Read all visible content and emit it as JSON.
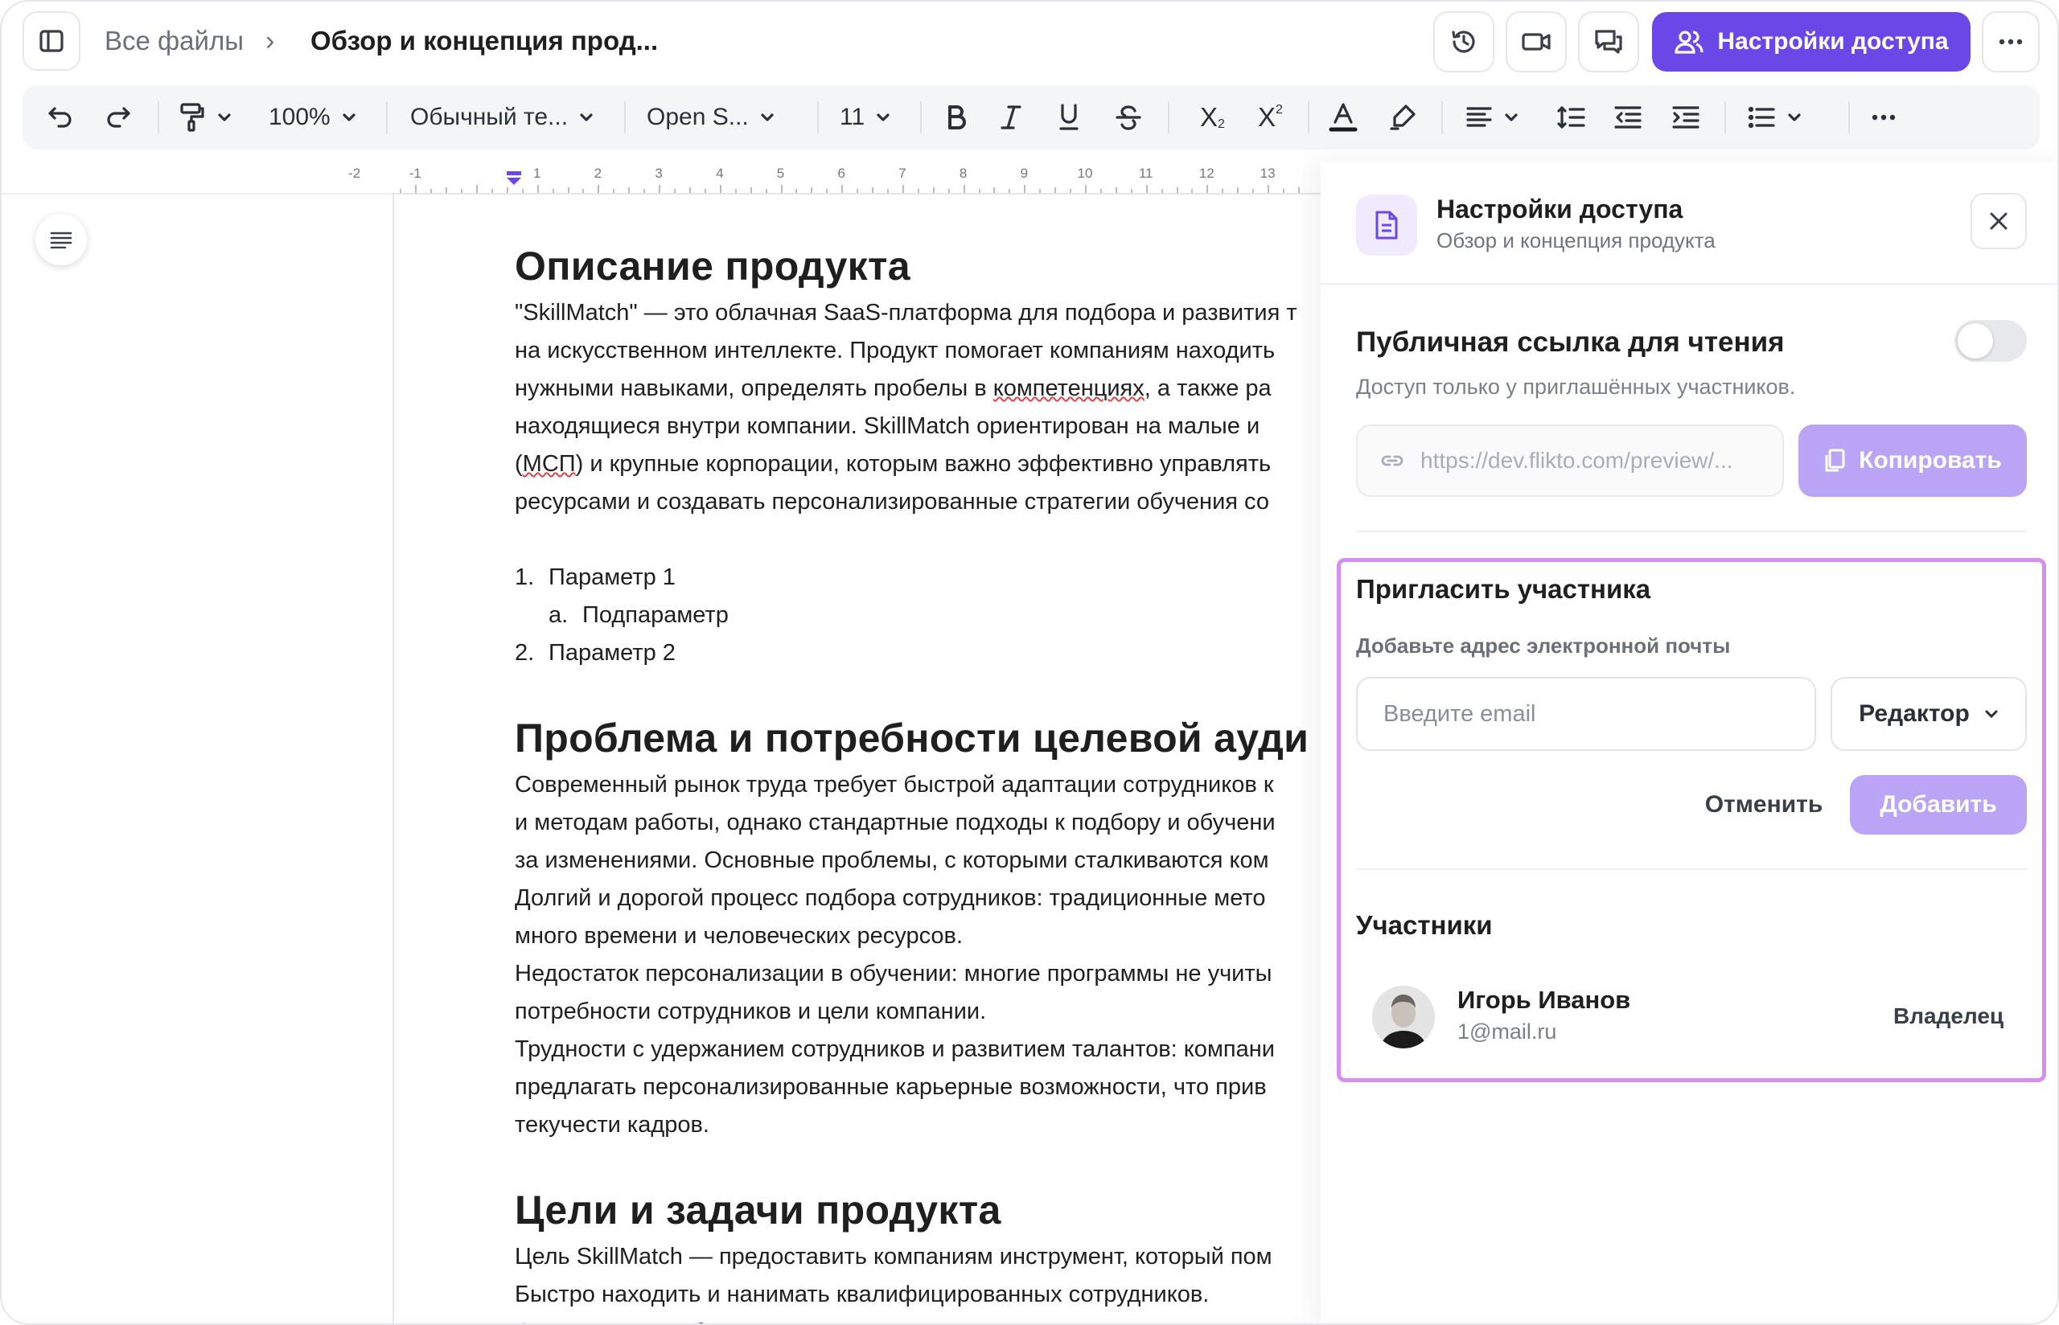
{
  "topbar": {
    "breadcrumb_root": "Все файлы",
    "breadcrumb_sep": "›",
    "document_title": "Обзор и концепция прод...",
    "access_button": "Настройки доступа"
  },
  "toolbar": {
    "zoom": "100%",
    "style": "Обычный те...",
    "font": "Open S...",
    "size": "11",
    "subscript_label": "X",
    "superscript_label": "X"
  },
  "ruler": {
    "numbers": [
      "-2",
      "-1",
      "1",
      "2",
      "3",
      "4",
      "5",
      "6",
      "7",
      "8",
      "9",
      "10",
      "11",
      "12",
      "13"
    ]
  },
  "document": {
    "h1": "Описание продукта",
    "p1": [
      "\"SkillMatch\" — это облачная SaaS-платформа для подбора и развития т",
      "на искусственном интеллекте. Продукт помогает компаниям находить",
      "нужными навыками, определять пробелы в компетенциях, а также ра",
      "находящиеся внутри компании. SkillMatch ориентирован на малые и",
      "(МСП) и крупные корпорации, которым важно эффективно управлять",
      "ресурсами и создавать персонализированные стратегии обучения со"
    ],
    "list": [
      {
        "marker": "1.",
        "text": "Параметр 1"
      },
      {
        "marker": "a.",
        "text": "Подпараметр"
      },
      {
        "marker": "2.",
        "text": "Параметр 2"
      }
    ],
    "h2": "Проблема и потребности целевой ауди",
    "p2": [
      "Современный рынок труда требует быстрой адаптации сотрудников к",
      "и методам работы, однако стандартные подходы к подбору и обучени",
      "за изменениями. Основные проблемы, с которыми сталкиваются ком",
      "Долгий и дорогой процесс подбора сотрудников: традиционные мето",
      "много времени и человеческих ресурсов.",
      "Недостаток персонализации в обучении: многие программы не учиты",
      "потребности сотрудников и цели компании.",
      "Трудности с удержанием сотрудников и развитием талантов: компани",
      "предлагать персонализированные карьерные возможности, что прив",
      "текучести кадров."
    ],
    "h3": "Цели и задачи продукта",
    "p3": [
      "Цель SkillMatch — предоставить компаниям инструмент, который пом",
      "Быстро находить и нанимать квалифицированных сотрудников.",
      "Определять пробелы в навыках и строить персонализированные пла"
    ]
  },
  "panel": {
    "title": "Настройки доступа",
    "subtitle": "Обзор и концепция продукта",
    "public_link_title": "Публичная ссылка для чтения",
    "public_link_desc": "Доступ только у приглашённых участников.",
    "public_link_enabled": false,
    "link_url": "https://dev.flikto.com/preview/...",
    "copy_button": "Копировать",
    "invite_title": "Пригласить участника",
    "invite_label": "Добавьте адрес электронной почты",
    "email_placeholder": "Введите email",
    "role": "Редактор",
    "cancel_button": "Отменить",
    "add_button": "Добавить",
    "members_title": "Участники",
    "members": [
      {
        "name": "Игорь Иванов",
        "email": "1@mail.ru",
        "role": "Владелец"
      }
    ]
  },
  "colors": {
    "accent": "#6c47e8",
    "accent_disabled": "#b9a4f5",
    "highlight": "#d48ff0"
  }
}
